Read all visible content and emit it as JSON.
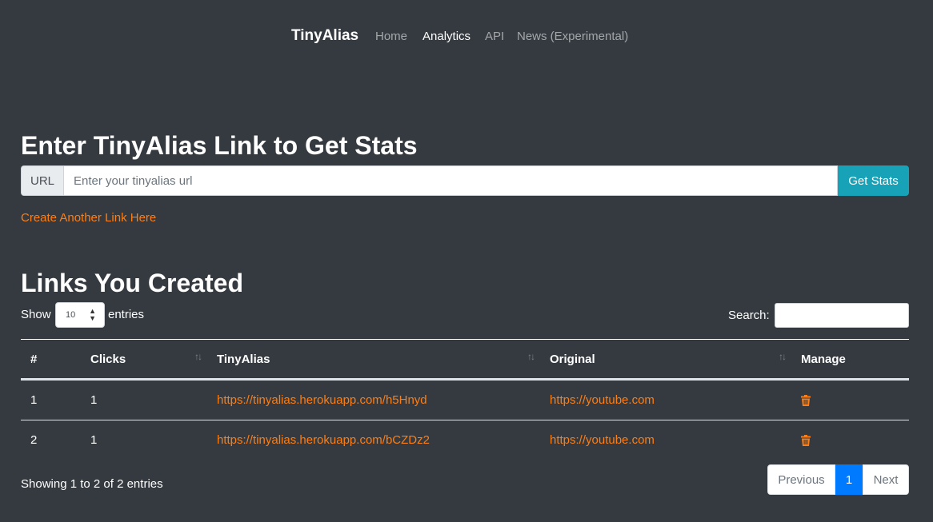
{
  "navbar": {
    "brand": "TinyAlias",
    "links": [
      "Home",
      "Analytics",
      "API",
      "News (Experimental)"
    ],
    "active": "Analytics"
  },
  "stats": {
    "heading": "Enter TinyAlias Link to Get Stats",
    "prepend": "URL",
    "placeholder": "Enter your tinyalias url",
    "button": "Get Stats",
    "create_link": "Create Another Link Here"
  },
  "links_section": {
    "heading": "Links You Created",
    "show_label": "Show",
    "entries_value": "10",
    "entries_label": "entries",
    "search_label": "Search:",
    "columns": [
      "#",
      "Clicks",
      "TinyAlias",
      "Original",
      "Manage"
    ],
    "rows": [
      {
        "num": "1",
        "clicks": "1",
        "alias": "https://tinyalias.herokuapp.com/h5Hnyd",
        "original": "https://youtube.com"
      },
      {
        "num": "2",
        "clicks": "1",
        "alias": "https://tinyalias.herokuapp.com/bCZDz2",
        "original": "https://youtube.com"
      }
    ],
    "info": "Showing 1 to 2 of 2 entries",
    "pagination": {
      "previous": "Previous",
      "current": "1",
      "next": "Next"
    }
  },
  "colors": {
    "background": "#343a40",
    "link": "#fd7e14",
    "info_button": "#17a2b8",
    "page_active": "#007bff"
  }
}
